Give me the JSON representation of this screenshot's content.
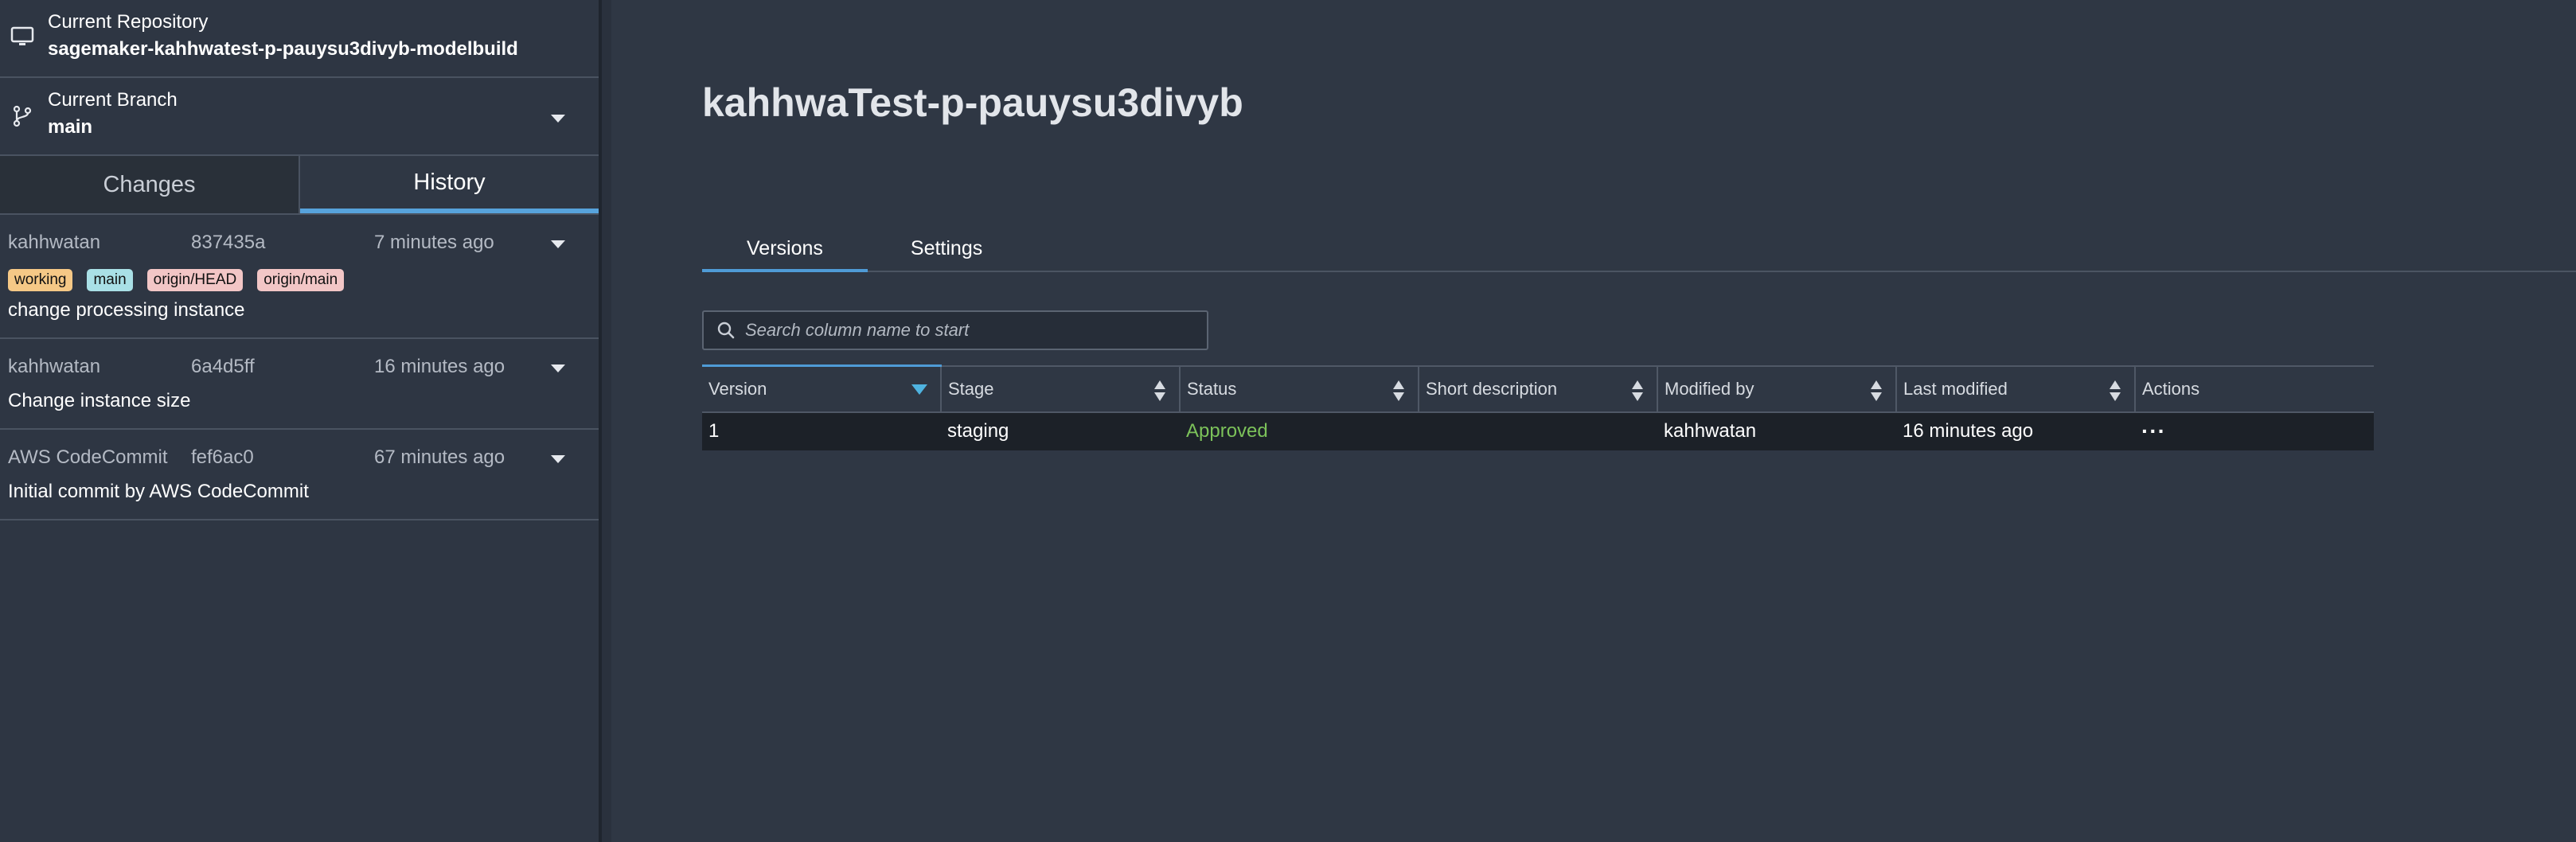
{
  "git": {
    "repo": {
      "label": "Current Repository",
      "value": "sagemaker-kahhwatest-p-pauysu3divyb-modelbuild"
    },
    "branch": {
      "label": "Current Branch",
      "value": "main"
    },
    "tabs": [
      {
        "label": "Changes"
      },
      {
        "label": "History"
      }
    ],
    "commits": [
      {
        "author": "kahhwatan",
        "sha": "837435a",
        "time": "7 minutes ago",
        "tags": [
          "working",
          "main",
          "origin/HEAD",
          "origin/main"
        ],
        "message": "change processing instance"
      },
      {
        "author": "kahhwatan",
        "sha": "6a4d5ff",
        "time": "16 minutes ago",
        "message": "Change instance size"
      },
      {
        "author": "AWS CodeCommit",
        "sha": "fef6ac0",
        "time": "67 minutes ago",
        "message": "Initial commit by AWS CodeCommit"
      }
    ]
  },
  "model": {
    "title": "kahhwaTest-p-pauysu3divyb",
    "tabs": [
      {
        "label": "Versions"
      },
      {
        "label": "Settings"
      }
    ],
    "search": {
      "placeholder": "Search column name to start"
    },
    "table": {
      "columns": [
        "Version",
        "Stage",
        "Status",
        "Short description",
        "Modified by",
        "Last modified",
        "Actions"
      ],
      "rows": [
        {
          "version": "1",
          "stage": "staging",
          "status": "Approved",
          "description": "",
          "modified_by": "kahhwatan",
          "last_modified": "16 minutes ago",
          "actions": "···"
        }
      ]
    }
  },
  "colors": {
    "accent": "#4f9bd6",
    "approved": "#7cc25a",
    "tag_working": "#f5c886",
    "tag_main": "#a9e0e6",
    "tag_origin": "#f2c6c6"
  }
}
